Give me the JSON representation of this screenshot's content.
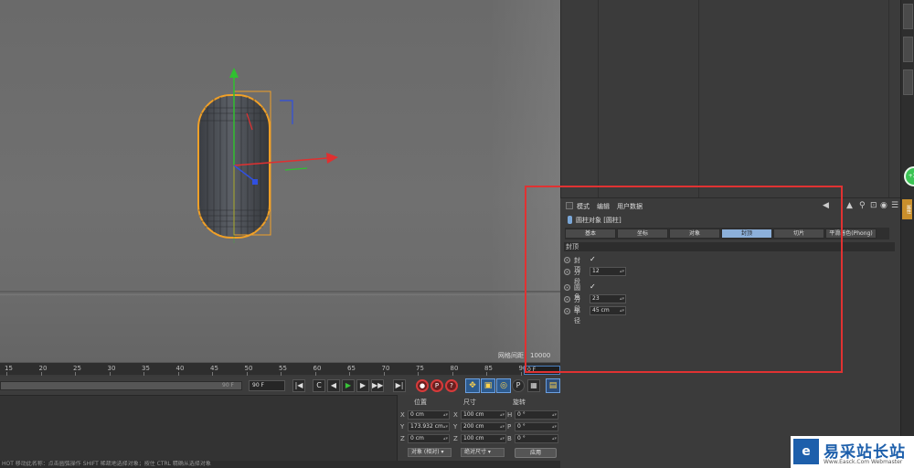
{
  "viewport": {
    "grid_spacing": "网格间距：10000 cm"
  },
  "timeline": {
    "ticks": [
      "15",
      "20",
      "25",
      "30",
      "35",
      "40",
      "45",
      "50",
      "55",
      "60",
      "65",
      "70",
      "75",
      "80",
      "85",
      "90"
    ],
    "current_frame": "0 F",
    "range_end": "90 F",
    "end_field": "90 F"
  },
  "transport": {
    "go_start": "|◀",
    "prev_key": "◀◀",
    "prev_frame": "◀",
    "play": "▶",
    "next_frame": "▶",
    "next_key": "▶▶",
    "go_end": "▶|",
    "loop": "C",
    "record_labels": [
      "●",
      "P",
      "?"
    ]
  },
  "coords": {
    "headers": [
      "位置",
      "尺寸",
      "旋转"
    ],
    "rows": [
      {
        "axis": "X",
        "position": "0 cm",
        "size_axis": "X",
        "size": "100 cm",
        "rot_axis": "H",
        "rotation": "0 °"
      },
      {
        "axis": "Y",
        "position": "173.932 cm",
        "size_axis": "Y",
        "size": "200 cm",
        "rot_axis": "P",
        "rotation": "0 °"
      },
      {
        "axis": "Z",
        "position": "0 cm",
        "size_axis": "Z",
        "size": "100 cm",
        "rot_axis": "B",
        "rotation": "0 °"
      }
    ],
    "mode_dropdown": "对象 (相对)",
    "size_dropdown": "绝对尺寸",
    "apply_label": "应用"
  },
  "status_bar": "HOT 移动此名称：点击圆弧操作 SHIFT 稀疏地选择对象；按住 CTRL 精确从选择对象",
  "attributes": {
    "menu": [
      "模式",
      "编辑",
      "用户数据"
    ],
    "object_title": "圆柱对象 [圆柱]",
    "tabs": [
      "基本",
      "坐标",
      "对象",
      "封顶",
      "切片",
      "平滑着色(Phong)"
    ],
    "active_tab": "封顶",
    "section_header": "封顶",
    "params": [
      {
        "label": "封顶",
        "type": "check",
        "value": "✓"
      },
      {
        "label": "分段",
        "type": "field",
        "value": "12"
      },
      {
        "label": "圆角",
        "type": "check",
        "value": "✓"
      },
      {
        "label": "分段",
        "type": "field",
        "value": "23"
      },
      {
        "label": "半径",
        "type": "field",
        "value": "45 cm"
      }
    ]
  },
  "right_strip": {
    "green_badge": "+30",
    "orange_tab": "属性"
  },
  "watermark": {
    "logo": "e",
    "title": "易采站长站",
    "url": "Www.Easck.Com  Webmaster"
  },
  "colors": {
    "highlight": "#e03232",
    "active_tab": "#8cb0da",
    "capsule_outline": "#f0a028",
    "axis_x": "#e03030",
    "axis_y": "#30c030",
    "axis_z": "#3050e0"
  }
}
